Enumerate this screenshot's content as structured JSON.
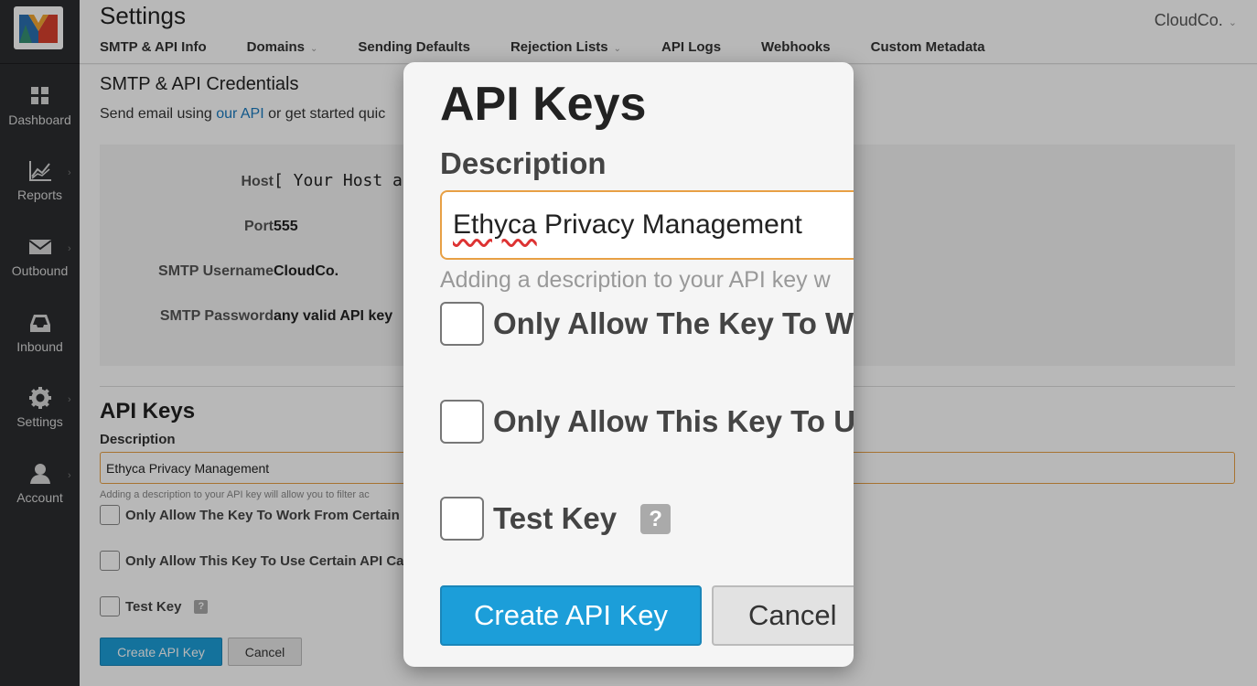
{
  "colors": {
    "accent": "#1c9ed9",
    "link": "#1a7bbf",
    "input_focus_border": "#e8a045",
    "sidebar_bg": "#2b2d30"
  },
  "logo": {
    "letter": "M",
    "icon": "mandrill-logo"
  },
  "sidebar": {
    "items": [
      {
        "label": "Dashboard",
        "icon": "grid-icon",
        "has_chevron": false
      },
      {
        "label": "Reports",
        "icon": "chart-icon",
        "has_chevron": true
      },
      {
        "label": "Outbound",
        "icon": "envelope-icon",
        "has_chevron": true
      },
      {
        "label": "Inbound",
        "icon": "inbox-icon",
        "has_chevron": false
      },
      {
        "label": "Settings",
        "icon": "gear-icon",
        "has_chevron": true
      },
      {
        "label": "Account",
        "icon": "user-icon",
        "has_chevron": true
      }
    ],
    "chevron": "›"
  },
  "header": {
    "title": "Settings",
    "account": "CloudCo.",
    "tabs": [
      {
        "label": "SMTP & API Info",
        "dropdown": false
      },
      {
        "label": "Domains",
        "dropdown": true
      },
      {
        "label": "Sending Defaults",
        "dropdown": false
      },
      {
        "label": "Rejection Lists",
        "dropdown": true
      },
      {
        "label": "API Logs",
        "dropdown": false
      },
      {
        "label": "Webhooks",
        "dropdown": false
      },
      {
        "label": "Custom Metadata",
        "dropdown": false
      }
    ]
  },
  "credentials": {
    "title": "SMTP & API Credentials",
    "desc_before": "Send email using ",
    "desc_link": "our API",
    "desc_after": " or get started quic",
    "rows": [
      {
        "label": "Host",
        "value": "[ Your Host app"
      },
      {
        "label": "Port",
        "value": "555"
      },
      {
        "label": "SMTP Username",
        "value": "CloudCo."
      },
      {
        "label": "SMTP Password",
        "value": "any valid API key"
      }
    ]
  },
  "api_keys": {
    "title": "API Keys",
    "description_label": "Description",
    "description_value": "Ethyca Privacy Management",
    "help_text": "Adding a description to your API key will allow you to filter ac",
    "options": [
      {
        "label": "Only Allow The Key To Work From Certain",
        "checked": false
      },
      {
        "label": "Only Allow This Key To Use Certain API Ca",
        "checked": false
      },
      {
        "label": "Test Key",
        "checked": false,
        "help": "?"
      }
    ],
    "create_label": "Create API Key",
    "cancel_label": "Cancel"
  },
  "modal": {
    "title": "API Keys",
    "description_label": "Description",
    "description_word1": "Ethyca",
    "description_rest": " Privacy Management",
    "help_text": "Adding a description to your API key w",
    "options": [
      {
        "label": "Only Allow The Key To Wo",
        "checked": false
      },
      {
        "label": "Only Allow This Key To Us",
        "checked": false
      },
      {
        "label": "Test Key",
        "checked": false,
        "help": "?"
      }
    ],
    "create_label": "Create API Key",
    "cancel_label": "Cancel"
  }
}
